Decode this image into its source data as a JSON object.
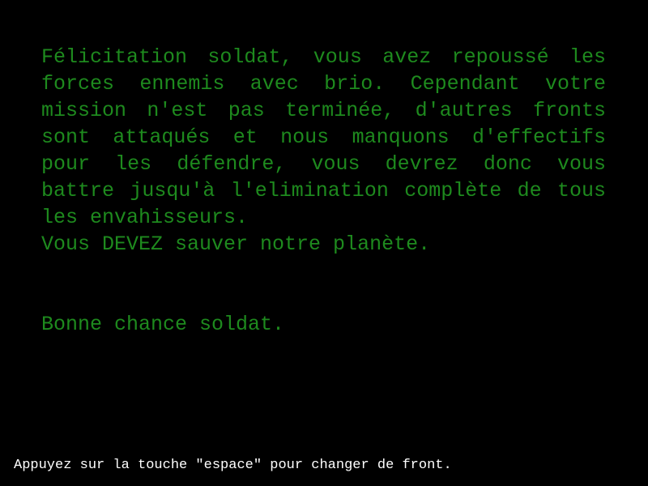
{
  "colors": {
    "background": "#000000",
    "story_text": "#1e8a1e",
    "hint_text": "#ffffff"
  },
  "story": {
    "paragraph_1": "Félicitation soldat, vous avez repoussé les forces ennemis avec brio. Cependant votre mission n'est pas terminée, d'autres fronts sont attaqués et nous manquons d'effectifs pour les défendre, vous devrez donc vous battre jusqu'à l'elimination complète de tous les envahisseurs.",
    "paragraph_2": "Vous DEVEZ sauver notre planète.",
    "closing": "Bonne chance soldat."
  },
  "footer": {
    "hint": "Appuyez sur la touche \"espace\" pour changer de front."
  }
}
